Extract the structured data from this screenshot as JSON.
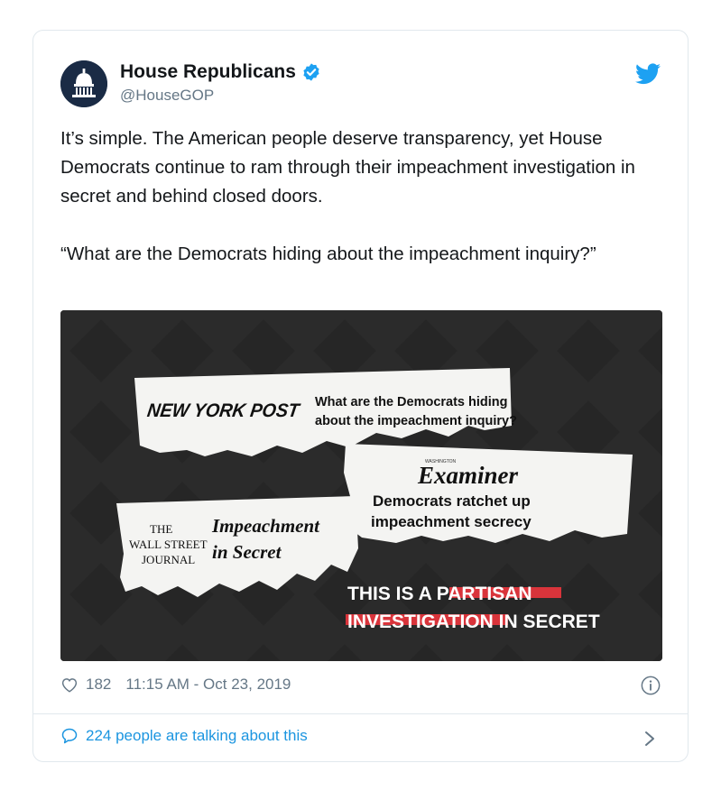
{
  "tweet": {
    "author_name": "House Republicans",
    "author_handle": "@HouseGOP",
    "paragraph1": "It’s simple. The American people deserve transparency, yet House Democrats continue to ram through their impeachment investigation in secret and behind closed doors.",
    "paragraph2": "“What are the Democrats hiding about the impeachment inquiry?”",
    "likes": "182",
    "timestamp": "11:15 AM - Oct 23, 2019",
    "talking": "224 people are talking about this"
  },
  "media": {
    "nyp_logo": "NEW YORK POST",
    "nyp_headline_line1": "What are the Democrats hiding",
    "nyp_headline_line2": "about the impeachment inquiry?",
    "examiner_small": "WASHINGTON",
    "examiner_logo": "Examiner",
    "examiner_headline_line1": "Democrats ratchet up",
    "examiner_headline_line2": "impeachment secrecy",
    "wsj_logo_line1": "THE",
    "wsj_logo_line2": "WALL STREET",
    "wsj_logo_line3": "JOURNAL",
    "wsj_headline_line1": "Impeachment",
    "wsj_headline_line2": "in Secret",
    "banner_line1_a": "THIS IS A ",
    "banner_line1_b": "PARTISAN",
    "banner_line2_a": "INVESTIGATION",
    "banner_line2_b": " IN SECRET"
  },
  "icons": {
    "avatar": "capitol-dome-icon",
    "verified": "verified-badge-icon",
    "brand": "twitter-bird-icon",
    "like": "heart-icon",
    "info": "info-icon",
    "reply": "speech-bubble-icon",
    "more": "chevron-right-icon"
  },
  "colors": {
    "accent": "#1da1f2",
    "link": "#1b95e0",
    "text": "#14171a",
    "muted": "#657786",
    "highlight": "#d9343b",
    "media_bg": "#2b2b2b"
  }
}
